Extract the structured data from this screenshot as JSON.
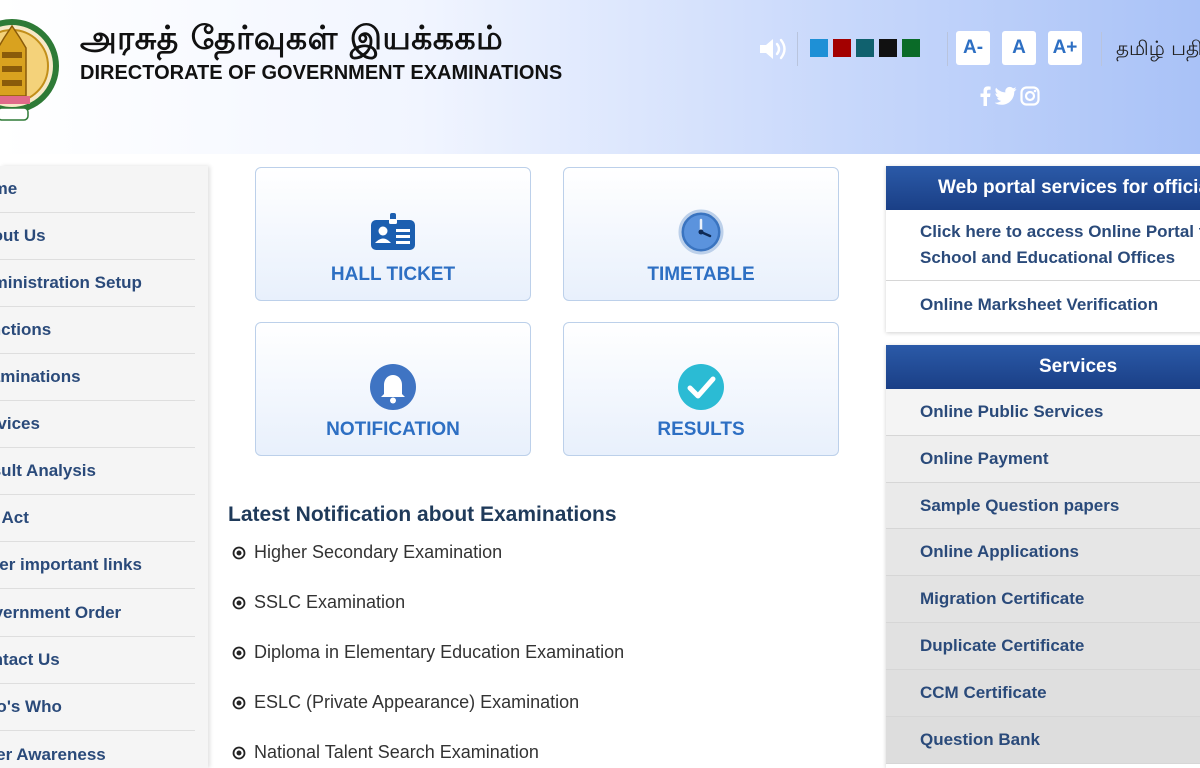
{
  "header": {
    "title_tamil": "அரசுத் தேர்வுகள் இயக்ககம்",
    "title_english": "DIRECTORATE OF GOVERNMENT EXAMINATIONS",
    "theme_colors": [
      "#1e90d6",
      "#a30000",
      "#10616e",
      "#111111",
      "#0a6b28"
    ],
    "font_buttons": [
      "A-",
      "A",
      "A+"
    ],
    "language_link": "தமிழ் பதிப்பு",
    "social_icons": [
      "facebook-icon",
      "twitter-icon",
      "instagram-icon"
    ]
  },
  "sidebar": {
    "items": [
      {
        "label": "Home"
      },
      {
        "label": "About Us"
      },
      {
        "label": "Administration Setup"
      },
      {
        "label": "Functions"
      },
      {
        "label": "Examinations"
      },
      {
        "label": "Services"
      },
      {
        "label": "Result Analysis"
      },
      {
        "label": "RTI Act"
      },
      {
        "label": "Other important links"
      },
      {
        "label": "Government Order"
      },
      {
        "label": "Contact Us"
      },
      {
        "label": "Who's Who"
      },
      {
        "label": "Voter Awareness"
      }
    ]
  },
  "tiles": {
    "hall_ticket": "HALL TICKET",
    "timetable": "TIMETABLE",
    "notification": "NOTIFICATION",
    "results": "RESULTS"
  },
  "notifications": {
    "title": "Latest Notification about Examinations",
    "items": [
      "Higher Secondary Examination",
      "SSLC Examination",
      "Diploma in Elementary Education Examination",
      "ESLC (Private Appearance) Examination",
      "National Talent Search Examination"
    ]
  },
  "officials_panel": {
    "title": "Web portal services for officials",
    "row1_line1": "Click here to access Online Portal for",
    "row1_line2": "School and Educational Offices",
    "row2": "Online Marksheet Verification"
  },
  "services_panel": {
    "title": "Services",
    "items": [
      "Online Public Services",
      "Online Payment",
      "Sample Question papers",
      "Online Applications",
      "Migration Certificate",
      "Duplicate Certificate",
      "CCM Certificate",
      "Question Bank"
    ]
  }
}
